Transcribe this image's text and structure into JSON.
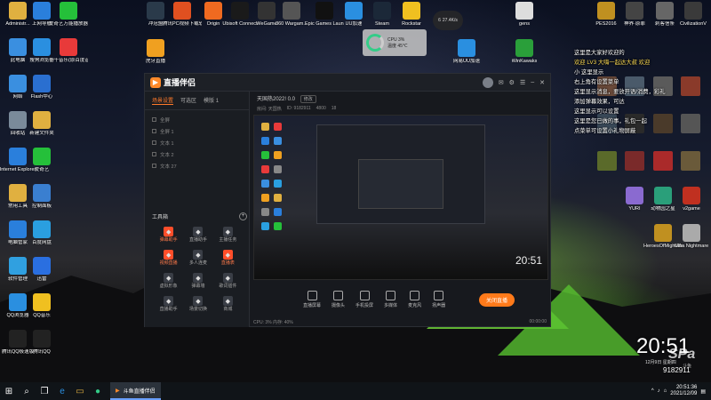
{
  "desktop_left": [
    {
      "label": "Administr...",
      "icon": "user-folder-icon",
      "color": "#e0b040"
    },
    {
      "label": "此电脑",
      "icon": "computer-icon",
      "color": "#3a8fe0"
    },
    {
      "label": "网络",
      "icon": "network-icon",
      "color": "#3a8fe0"
    },
    {
      "label": "回收站",
      "icon": "recycle-bin-icon",
      "color": "#7a8a9a"
    },
    {
      "label": "Internet Explorer",
      "icon": "ie-icon",
      "color": "#2a7fdc"
    },
    {
      "label": "常用工具",
      "icon": "toolbox-icon",
      "color": "#e0b040"
    },
    {
      "label": "电脑管家",
      "icon": "shield-icon",
      "color": "#2a7fdc"
    },
    {
      "label": "软件管理",
      "icon": "apps-icon",
      "color": "#30a0e0"
    },
    {
      "label": "QQ浏览器",
      "icon": "qq-browser-icon",
      "color": "#2a8fe0"
    },
    {
      "label": "腾讯QQ极速版",
      "icon": "qq-icon",
      "color": "#222"
    }
  ],
  "desktop_left2": [
    {
      "label": "上网导航",
      "icon": "ie-icon",
      "color": "#2a7fdc"
    },
    {
      "label": "搜狗浏览器",
      "icon": "sogou-icon",
      "color": "#2a8fe0"
    },
    {
      "label": "Flash中心",
      "icon": "flash-icon",
      "color": "#2a6fd0"
    },
    {
      "label": "新建文件夹",
      "icon": "folder-icon",
      "color": "#e0b040"
    },
    {
      "label": "爱奇艺",
      "icon": "iqiyi-icon",
      "color": "#25c03a"
    },
    {
      "label": "控制面板",
      "icon": "control-panel-icon",
      "color": "#3a7fd0"
    },
    {
      "label": "百度网盘",
      "icon": "cloud-icon",
      "color": "#2a9fe0"
    },
    {
      "label": "迅雷",
      "icon": "thunder-icon",
      "color": "#2a6fe0"
    },
    {
      "label": "QQ音乐",
      "icon": "qq-music-icon",
      "color": "#f0c020"
    },
    {
      "label": "腾讯QQ",
      "icon": "qq-icon",
      "color": "#222"
    }
  ],
  "desktop_left3": [
    {
      "label": "爱奇艺万能播放器",
      "icon": "player-icon",
      "color": "#25c03a"
    },
    {
      "label": "千千音乐(原百度音乐)",
      "icon": "music-icon",
      "color": "#e83a3a"
    }
  ],
  "desktop_top": [
    {
      "label": "冲冠盟",
      "icon": "google-play-icon",
      "color": "#2a3a4a"
    },
    {
      "label": "虎牙直播",
      "icon": "huya-icon",
      "color": "#f0a020"
    },
    {
      "label": "腾讯PC视频下载软件",
      "icon": "video-download-icon",
      "color": "#e05020"
    },
    {
      "label": "Origin",
      "icon": "origin-icon",
      "color": "#f06a20"
    },
    {
      "label": "Ubisoft Connect",
      "icon": "ubisoft-icon",
      "color": "#1a1a1a"
    },
    {
      "label": "WeGame",
      "icon": "wegame-icon",
      "color": "#333"
    },
    {
      "label": "360 Wargam...",
      "icon": "wargame-icon",
      "color": "#555"
    },
    {
      "label": "Epic Games Launcher",
      "icon": "epic-icon",
      "color": "#111"
    },
    {
      "label": "UU加速",
      "icon": "uu-icon",
      "color": "#2a8fe0"
    },
    {
      "label": "Steam",
      "icon": "steam-icon",
      "color": "#1b2838"
    },
    {
      "label": "Rockstar",
      "icon": "rockstar-icon",
      "color": "#f0c020"
    },
    {
      "label": "网易UU加速",
      "icon": "netease-uu-icon",
      "color": "#2a8fe0"
    },
    {
      "label": "gens",
      "icon": "gens-icon",
      "color": "#ddd"
    },
    {
      "label": "WinKawaks",
      "icon": "winkawaks-icon",
      "color": "#2a9f3a"
    }
  ],
  "desktop_right": [
    {
      "label": "PES2016",
      "icon": "pes-icon",
      "color": "#c09020"
    },
    {
      "label": "神界·原罪",
      "icon": "game-icon",
      "color": "#444"
    },
    {
      "label": "刺客信条",
      "icon": "assassin-icon",
      "color": "#666"
    },
    {
      "label": "CivilizationV",
      "icon": "civ-icon",
      "color": "#3a3a3a"
    },
    {
      "label": "YURI",
      "icon": "yuri-icon",
      "color": "#8a6ad0"
    },
    {
      "label": "动物园之星",
      "icon": "zoo-icon",
      "color": "#2a9f7a"
    },
    {
      "label": "v2game",
      "icon": "v2game-icon",
      "color": "#c03020"
    },
    {
      "label": "HeroesOfMight&Magic5",
      "icon": "heroes-icon",
      "color": "#c09020"
    },
    {
      "label": "Ultra Nightmare",
      "icon": "ultra-icon",
      "color": "#aaa"
    }
  ],
  "perf_widget": {
    "title": "CPU 3%",
    "temp": "温度 45℃"
  },
  "net_bubble": {
    "value": "6",
    "speed": "27.4K/s"
  },
  "app": {
    "title": "直播伴侣",
    "tabs": [
      "场景设置",
      "可选区",
      "模版 1"
    ],
    "scenes": [
      "全屏",
      "全屏 1",
      "文本 1",
      "文本 2",
      "文本 27"
    ],
    "tools_title": "工具箱",
    "tools": [
      {
        "label": "弹幕助手",
        "hot": true,
        "icon": "danmu-icon"
      },
      {
        "label": "直播助手",
        "hot": false,
        "icon": "helper-icon"
      },
      {
        "label": "主播任务",
        "hot": false,
        "icon": "task-icon"
      },
      {
        "label": "视频直播",
        "hot": true,
        "icon": "video-live-icon"
      },
      {
        "label": "多人连麦",
        "hot": false,
        "icon": "multi-mic-icon"
      },
      {
        "label": "直播表",
        "hot": true,
        "icon": "schedule-icon"
      },
      {
        "label": "虚拟形象",
        "hot": false,
        "icon": "avatar-icon"
      },
      {
        "label": "弹幕墙",
        "hot": false,
        "icon": "danmu-wall-icon"
      },
      {
        "label": "歌词插件",
        "hot": false,
        "icon": "lyrics-icon"
      },
      {
        "label": "直播助手",
        "hot": false,
        "icon": "helper2-icon"
      },
      {
        "label": "场景切换",
        "hot": false,
        "icon": "switch-icon"
      },
      {
        "label": "商城",
        "hot": false,
        "icon": "shop-icon"
      }
    ],
    "room_title": "天国热2022! 0.0",
    "room_tag": "修改",
    "room_meta": [
      "房间: 天国热",
      "ID: 9182911",
      "4800",
      "18"
    ],
    "actions": [
      {
        "label": "直播屏幕",
        "icon": "screen-icon"
      },
      {
        "label": "摄像头",
        "icon": "camera-icon"
      },
      {
        "label": "手机投屏",
        "icon": "phone-icon"
      },
      {
        "label": "多媒体",
        "icon": "media-icon"
      },
      {
        "label": "麦克风",
        "icon": "mic-icon"
      },
      {
        "label": "扬声器",
        "icon": "speaker-icon"
      }
    ],
    "start_live": "关闭直播",
    "status_left": "CPU: 3%  内存: 40%",
    "status_right": "00:00:00",
    "preview_time": "20:51"
  },
  "chat": [
    {
      "text": "这里是大家好欢迎的",
      "hl": false
    },
    {
      "text": "欢迎 LV3 大嗨一起达大叔 欢迎",
      "hl": true
    },
    {
      "text": "小 这里显示",
      "hl": false
    },
    {
      "text": "右上角有设置菜单",
      "hl": false
    },
    {
      "text": "这里显示消息，要放开语/消费，彩礼",
      "hl": false
    },
    {
      "text": "添加弹幕效果，可达",
      "hl": false
    },
    {
      "text": "这里显示可以设置",
      "hl": false
    },
    {
      "text": "这里是您已做的事，礼包一起",
      "hl": false
    },
    {
      "text": "点菜单可设置小礼物屏蔽",
      "hl": false
    }
  ],
  "overlay": {
    "big_clock": "20:51",
    "date": "12月9日 星期四",
    "watermark": "SPa",
    "watermark_sub": "斗鱼",
    "room_number": "9182911"
  },
  "taskbar": {
    "app_label": "斗鱼直播伴侣",
    "time": "20:51:36",
    "date": "2021/12/09"
  }
}
